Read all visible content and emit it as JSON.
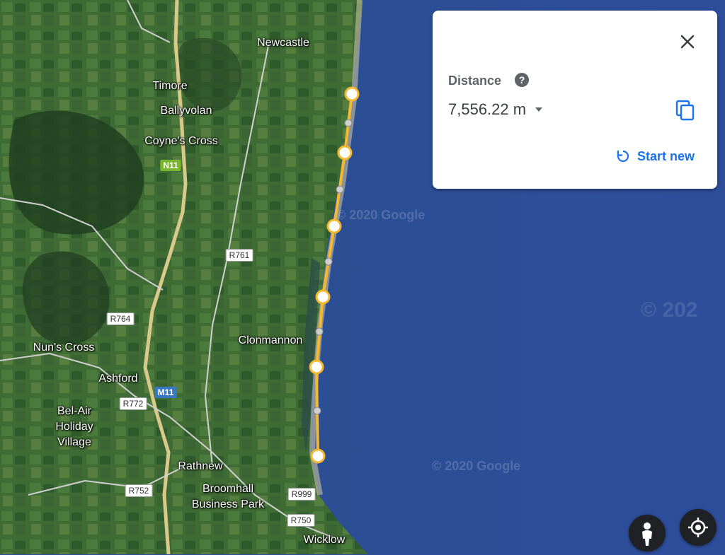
{
  "map": {
    "places": [
      {
        "id": "newcastle",
        "label": "Newcastle"
      },
      {
        "id": "timore",
        "label": "Timore"
      },
      {
        "id": "ballyvolan",
        "label": "Ballyvolan"
      },
      {
        "id": "coynes-cross",
        "label": "Coyne's Cross"
      },
      {
        "id": "clonmannon",
        "label": "Clonmannon"
      },
      {
        "id": "nuns-cross",
        "label": "Nun's Cross"
      },
      {
        "id": "ashford",
        "label": "Ashford"
      },
      {
        "id": "bel-air-1",
        "label": "Bel-Air"
      },
      {
        "id": "bel-air-2",
        "label": "Holiday"
      },
      {
        "id": "bel-air-3",
        "label": "Village"
      },
      {
        "id": "rathnew",
        "label": "Rathnew"
      },
      {
        "id": "broomhall-1",
        "label": "Broomhall"
      },
      {
        "id": "broomhall-2",
        "label": "Business Park"
      },
      {
        "id": "wicklow",
        "label": "Wicklow"
      }
    ],
    "road_signs": {
      "n11": "N11",
      "m11": "M11",
      "r761": "R761",
      "r764": "R764",
      "r772": "R772",
      "r752": "R752",
      "r999": "R999",
      "r750": "R750"
    },
    "watermark": "© 2020 Google",
    "watermark_partial": "© 202",
    "colors": {
      "measure_line": "#f5b82e",
      "sea": "#2f4f9e",
      "land": "#3d6b35"
    }
  },
  "measure_panel": {
    "title": "Distance",
    "value": "7,556.22 m",
    "start_new_label": "Start new",
    "icons": {
      "close": "close-icon",
      "help": "help-icon",
      "dropdown": "chevron-down-icon",
      "copy": "copy-icon",
      "restart": "restart-icon"
    }
  },
  "controls": {
    "pegman": "pegman-icon",
    "my_location": "my-location-icon"
  }
}
